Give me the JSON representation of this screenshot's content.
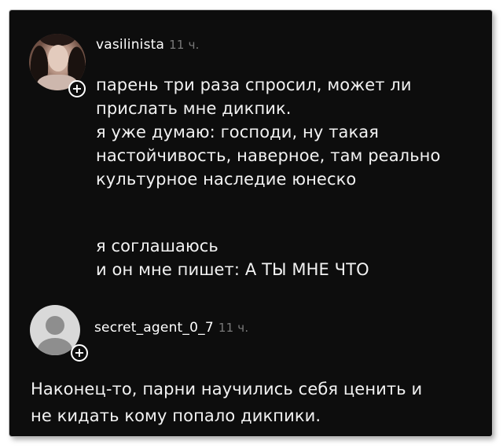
{
  "comments": [
    {
      "username": "vasilinista",
      "time": "11 ч.",
      "paragraphs": [
        "парень три раза спросил, может ли",
        "прислать мне дикпик.",
        "я уже думаю: господи, ну такая",
        "настойчивость, наверное, там реально",
        "культурное наследие юнеско"
      ],
      "paragraphs2": [
        "я соглашаюсь",
        "и он мне пишет: А ТЫ МНЕ ЧТО"
      ]
    },
    {
      "username": "secret_agent_0_7",
      "time": "11 ч.",
      "paragraphs": [
        "Наконец-то, парни научились себя ценить и",
        "не кидать кому попало дикпики."
      ]
    }
  ],
  "icons": {
    "follow": "plus-icon",
    "avatar_default": "user-silhouette-icon"
  },
  "colors": {
    "background": "#0d0d0d",
    "text": "#f2f2f2",
    "muted": "#7a7a7a"
  }
}
